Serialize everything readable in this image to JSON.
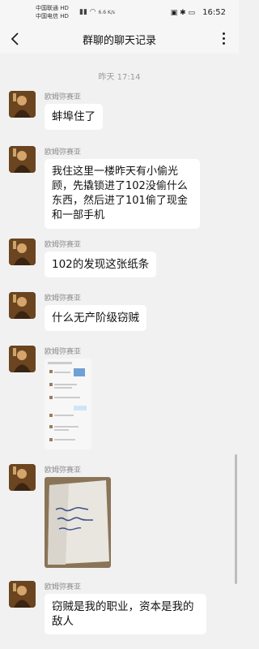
{
  "status_bar": {
    "carrier1": "中国联通 HD",
    "carrier2": "中国电信 HD",
    "speed": "6.6 K/s",
    "time": "16:52"
  },
  "header": {
    "title": "群聊的聊天记录"
  },
  "timestamp": "昨天 17:14",
  "sender_name": "欧姆弥赛亚",
  "messages": [
    {
      "text": "蚌埠住了"
    },
    {
      "text": "我住这里一楼昨天有小偷光顾，先撬锁进了102没偷什么东西，然后进了101偷了现金和一部手机"
    },
    {
      "text": "102的发现这张纸条"
    },
    {
      "text": "什么无产阶级窃贼"
    },
    {
      "image": "chat-screenshot"
    },
    {
      "image": "handwritten-note-photo"
    },
    {
      "text": "窃贼是我的职业，资本是我的敌人"
    }
  ],
  "colors": {
    "background": "#f1f1f1",
    "bubble": "#ffffff"
  }
}
